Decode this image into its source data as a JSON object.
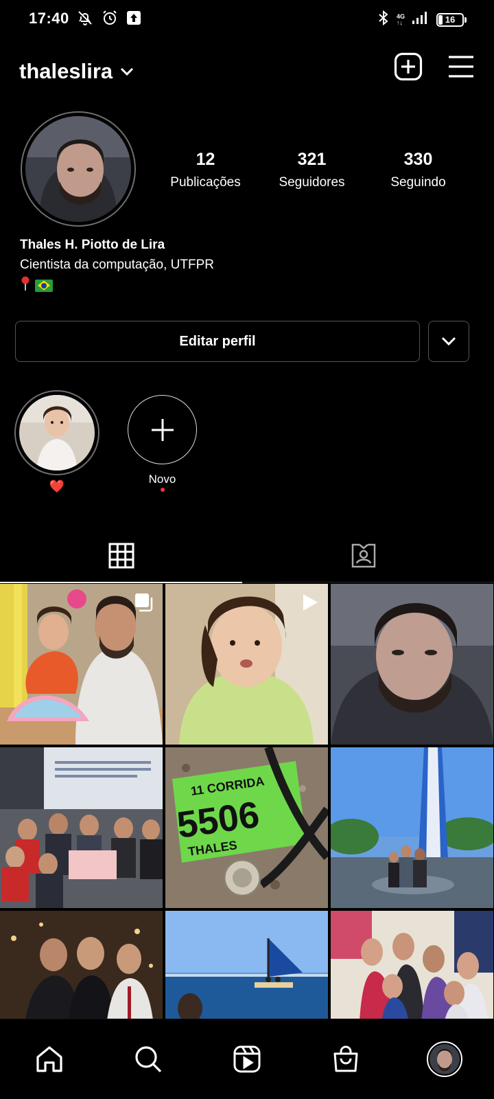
{
  "status_bar": {
    "time": "17:40",
    "network": "4G",
    "battery": "16",
    "icons": [
      "bell-off-icon",
      "alarm-icon",
      "upload-icon",
      "bluetooth-icon",
      "signal-icon",
      "battery-icon"
    ]
  },
  "header": {
    "username": "thaleslira",
    "icons": [
      "chevron-down-icon",
      "new-post-icon",
      "menu-icon"
    ]
  },
  "profile": {
    "stats": [
      {
        "value": "12",
        "label": "Publicações"
      },
      {
        "value": "321",
        "label": "Seguidores"
      },
      {
        "value": "330",
        "label": "Seguindo"
      }
    ],
    "name": "Thales H. Piotto de Lira",
    "bio": "Cientista da computação, UTFPR",
    "bio_emojis": [
      "pin-icon",
      "brazil-flag-icon"
    ]
  },
  "buttons": {
    "edit_profile": "Editar perfil"
  },
  "highlights": [
    {
      "label": "❤️"
    },
    {
      "label": "Novo"
    }
  ],
  "tabs": [
    "grid-icon",
    "tagged-icon"
  ],
  "grid": {
    "posts": [
      {
        "badge": "carousel"
      },
      {
        "badge": "video"
      },
      {
        "badge": ""
      },
      {
        "badge": ""
      },
      {
        "badge": ""
      },
      {
        "badge": ""
      },
      {
        "badge": ""
      },
      {
        "badge": ""
      },
      {
        "badge": ""
      }
    ]
  },
  "post_texts": {
    "race_bib_number": "5506",
    "race_bib_name": "THALES",
    "race_header": "11 CORRIDA"
  },
  "bottom_nav": [
    "home-icon",
    "search-icon",
    "reels-icon",
    "shop-icon",
    "profile-avatar"
  ]
}
